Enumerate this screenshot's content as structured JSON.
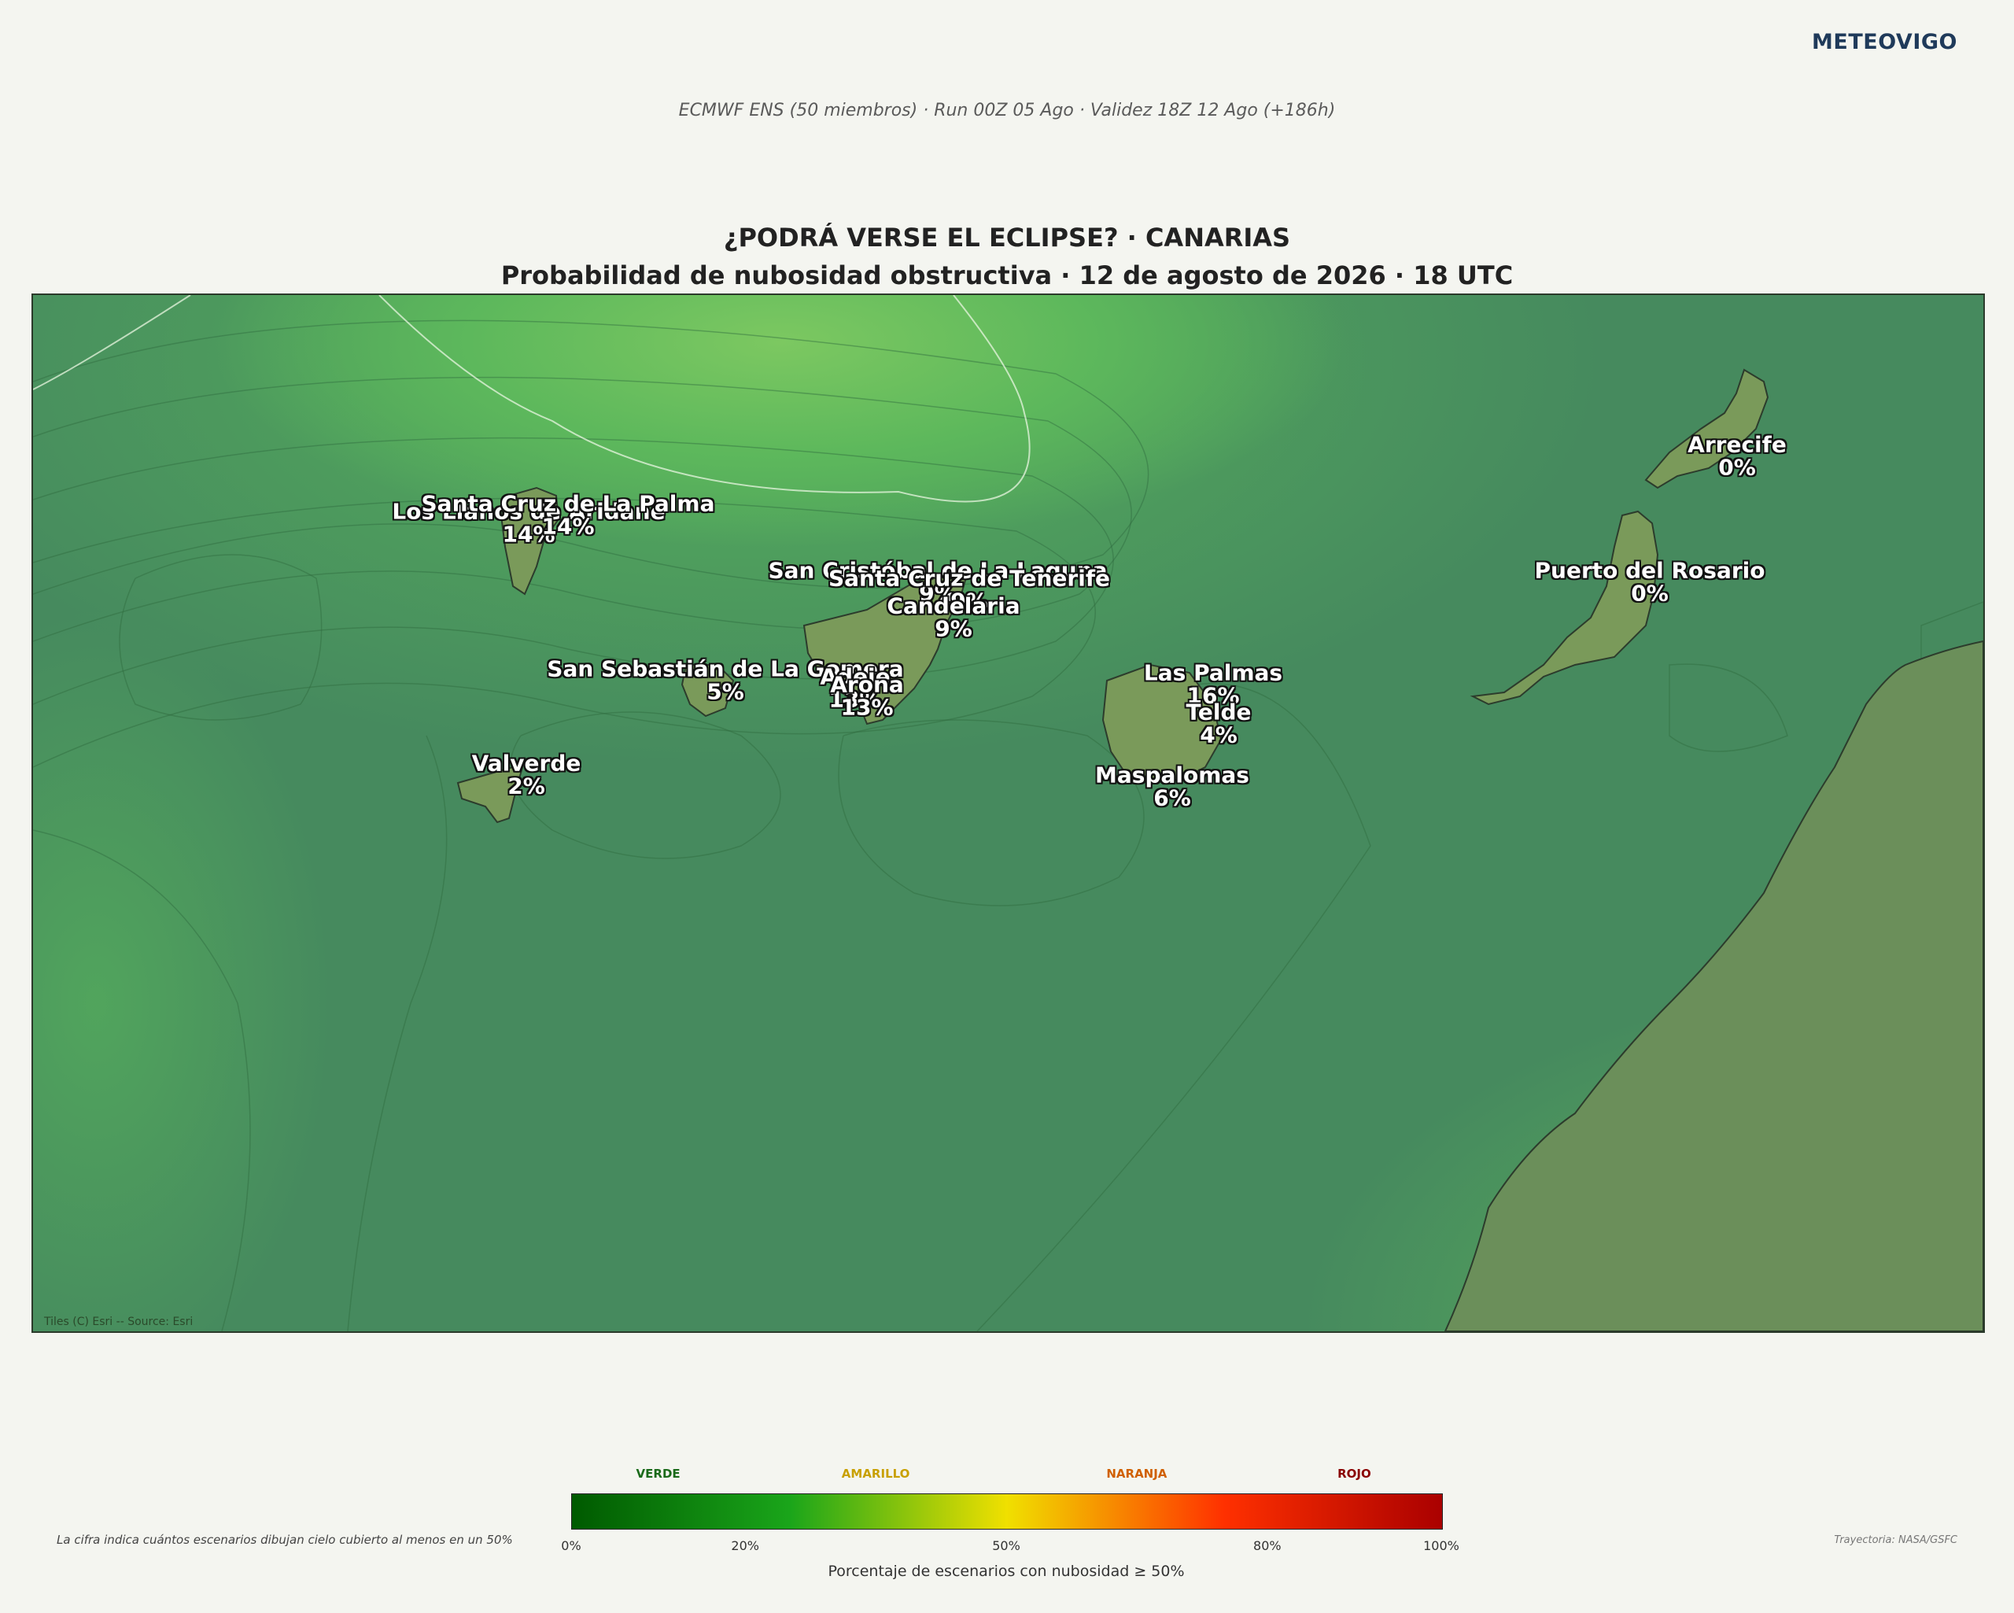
{
  "brand": "METEOVIGO",
  "subtitle": "ECMWF ENS (50 miembros) · Run 00Z 05 Ago · Validez 18Z 12 Ago (+186h)",
  "title": {
    "line1": "¿PODRÁ VERSE EL ECLIPSE? · CANARIAS",
    "line2": "Probabilidad de nubosidad obstructiva · 12 de agosto de 2026 · 18 UTC"
  },
  "map": {
    "attribution": "Tiles (C) Esri -- Source: Esri",
    "colors": {
      "low": "#468a5e",
      "mid": "#4da85c",
      "high": "#6ec45c",
      "land": "#7a9a5a",
      "africa": "#6b8f5a"
    },
    "cities": [
      {
        "name": "Los Llanos de Aridane",
        "value": "14%"
      },
      {
        "name": "Santa Cruz de La Palma",
        "value": "14%"
      },
      {
        "name": "San Cristóbal de La Laguna",
        "value": "9%"
      },
      {
        "name": "Santa Cruz de Tenerife",
        "value": "9%"
      },
      {
        "name": "Candelaria",
        "value": "9%"
      },
      {
        "name": "San Sebastián de La Gomera",
        "value": "5%"
      },
      {
        "name": "Adeje",
        "value": "13%"
      },
      {
        "name": "Arona",
        "value": "13%"
      },
      {
        "name": "Valverde",
        "value": "2%"
      },
      {
        "name": "Las Palmas",
        "value": "16%"
      },
      {
        "name": "Telde",
        "value": "4%"
      },
      {
        "name": "Maspalomas",
        "value": "6%"
      },
      {
        "name": "Arrecife",
        "value": "0%"
      },
      {
        "name": "Puerto del Rosario",
        "value": "0%"
      }
    ]
  },
  "legend": {
    "note": "La cifra indica cuántos escenarios dibujan cielo cubierto al menos en un 50%",
    "trajectory": "Trayectoria: NASA/GSFC",
    "label": "Porcentaje de escenarios con nubosidad ≥ 50%",
    "categories": [
      {
        "label": "VERDE",
        "color": "#1a6a1a"
      },
      {
        "label": "AMARILLO",
        "color": "#c8a000"
      },
      {
        "label": "NARANJA",
        "color": "#d06000"
      },
      {
        "label": "ROJO",
        "color": "#8a0000"
      }
    ],
    "ticks": [
      "0%",
      "20%",
      "50%",
      "80%",
      "100%"
    ],
    "tick_values": [
      0,
      20,
      50,
      80,
      100
    ],
    "gradient": [
      "#005a00",
      "#1aa51a",
      "#f0e000",
      "#ff3000",
      "#aa0000"
    ]
  }
}
